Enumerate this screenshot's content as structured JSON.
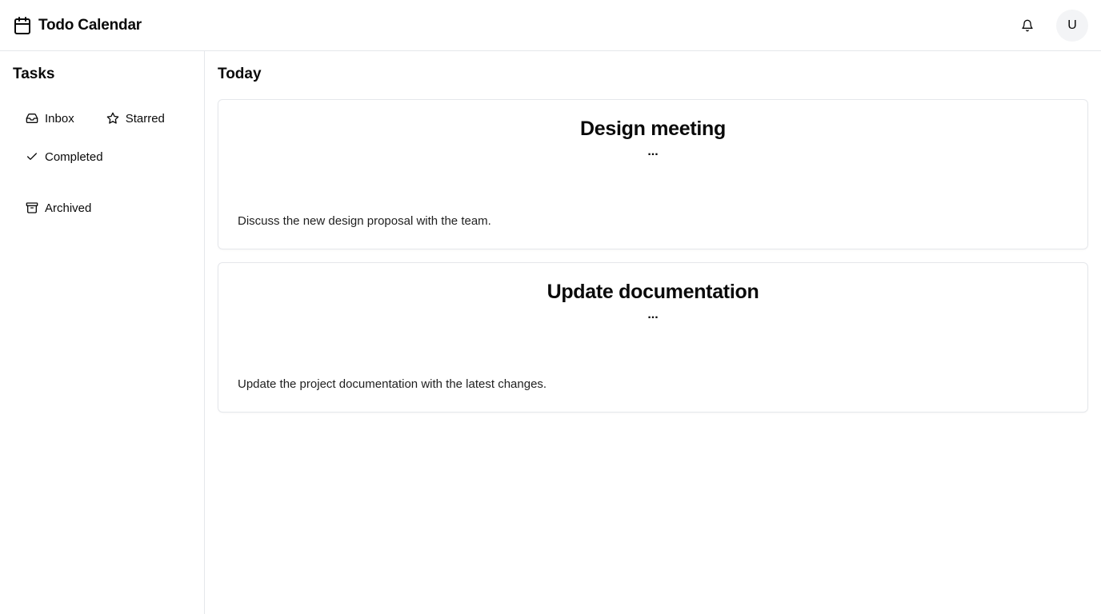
{
  "header": {
    "brand_icon": "calendar-icon",
    "title": "Todo Calendar",
    "bell_icon": "bell-icon",
    "avatar_initial": "U"
  },
  "sidebar": {
    "title": "Tasks",
    "items": [
      {
        "label": "Inbox",
        "icon": "inbox-icon"
      },
      {
        "label": "Starred",
        "icon": "star-icon"
      },
      {
        "label": "Completed",
        "icon": "check-icon"
      },
      {
        "label": "Archived",
        "icon": "archive-icon"
      }
    ]
  },
  "main": {
    "title": "Today",
    "cards": [
      {
        "title": "Design meeting",
        "more": "...",
        "description": "Discuss the new design proposal with the team."
      },
      {
        "title": "Update documentation",
        "more": "...",
        "description": "Update the project documentation with the latest changes."
      }
    ]
  },
  "colors": {
    "border": "#e5e7eb",
    "avatar_bg": "#f3f4f6",
    "text": "#0a0a0a"
  }
}
